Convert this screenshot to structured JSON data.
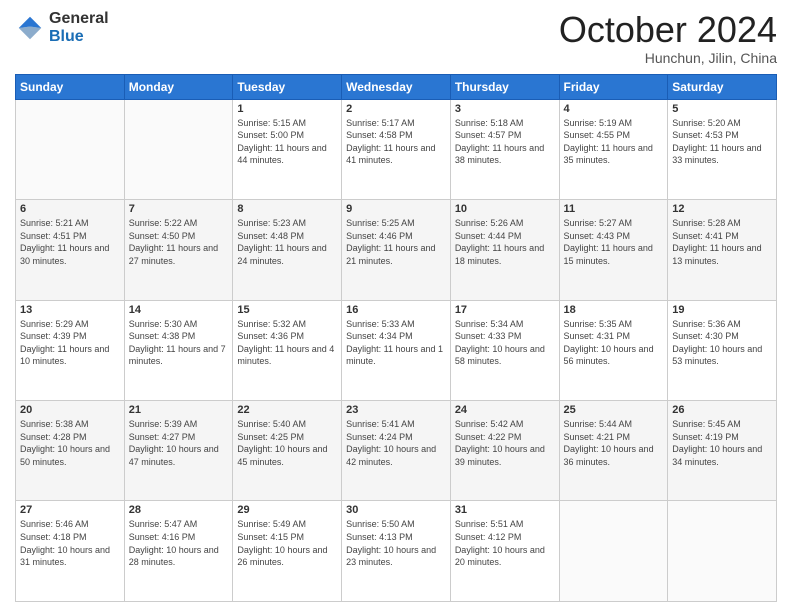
{
  "logo": {
    "general": "General",
    "blue": "Blue"
  },
  "header": {
    "month": "October 2024",
    "location": "Hunchun, Jilin, China"
  },
  "days_of_week": [
    "Sunday",
    "Monday",
    "Tuesday",
    "Wednesday",
    "Thursday",
    "Friday",
    "Saturday"
  ],
  "weeks": [
    [
      {
        "day": "",
        "sunrise": "",
        "sunset": "",
        "daylight": ""
      },
      {
        "day": "",
        "sunrise": "",
        "sunset": "",
        "daylight": ""
      },
      {
        "day": "1",
        "sunrise": "Sunrise: 5:15 AM",
        "sunset": "Sunset: 5:00 PM",
        "daylight": "Daylight: 11 hours and 44 minutes."
      },
      {
        "day": "2",
        "sunrise": "Sunrise: 5:17 AM",
        "sunset": "Sunset: 4:58 PM",
        "daylight": "Daylight: 11 hours and 41 minutes."
      },
      {
        "day": "3",
        "sunrise": "Sunrise: 5:18 AM",
        "sunset": "Sunset: 4:57 PM",
        "daylight": "Daylight: 11 hours and 38 minutes."
      },
      {
        "day": "4",
        "sunrise": "Sunrise: 5:19 AM",
        "sunset": "Sunset: 4:55 PM",
        "daylight": "Daylight: 11 hours and 35 minutes."
      },
      {
        "day": "5",
        "sunrise": "Sunrise: 5:20 AM",
        "sunset": "Sunset: 4:53 PM",
        "daylight": "Daylight: 11 hours and 33 minutes."
      }
    ],
    [
      {
        "day": "6",
        "sunrise": "Sunrise: 5:21 AM",
        "sunset": "Sunset: 4:51 PM",
        "daylight": "Daylight: 11 hours and 30 minutes."
      },
      {
        "day": "7",
        "sunrise": "Sunrise: 5:22 AM",
        "sunset": "Sunset: 4:50 PM",
        "daylight": "Daylight: 11 hours and 27 minutes."
      },
      {
        "day": "8",
        "sunrise": "Sunrise: 5:23 AM",
        "sunset": "Sunset: 4:48 PM",
        "daylight": "Daylight: 11 hours and 24 minutes."
      },
      {
        "day": "9",
        "sunrise": "Sunrise: 5:25 AM",
        "sunset": "Sunset: 4:46 PM",
        "daylight": "Daylight: 11 hours and 21 minutes."
      },
      {
        "day": "10",
        "sunrise": "Sunrise: 5:26 AM",
        "sunset": "Sunset: 4:44 PM",
        "daylight": "Daylight: 11 hours and 18 minutes."
      },
      {
        "day": "11",
        "sunrise": "Sunrise: 5:27 AM",
        "sunset": "Sunset: 4:43 PM",
        "daylight": "Daylight: 11 hours and 15 minutes."
      },
      {
        "day": "12",
        "sunrise": "Sunrise: 5:28 AM",
        "sunset": "Sunset: 4:41 PM",
        "daylight": "Daylight: 11 hours and 13 minutes."
      }
    ],
    [
      {
        "day": "13",
        "sunrise": "Sunrise: 5:29 AM",
        "sunset": "Sunset: 4:39 PM",
        "daylight": "Daylight: 11 hours and 10 minutes."
      },
      {
        "day": "14",
        "sunrise": "Sunrise: 5:30 AM",
        "sunset": "Sunset: 4:38 PM",
        "daylight": "Daylight: 11 hours and 7 minutes."
      },
      {
        "day": "15",
        "sunrise": "Sunrise: 5:32 AM",
        "sunset": "Sunset: 4:36 PM",
        "daylight": "Daylight: 11 hours and 4 minutes."
      },
      {
        "day": "16",
        "sunrise": "Sunrise: 5:33 AM",
        "sunset": "Sunset: 4:34 PM",
        "daylight": "Daylight: 11 hours and 1 minute."
      },
      {
        "day": "17",
        "sunrise": "Sunrise: 5:34 AM",
        "sunset": "Sunset: 4:33 PM",
        "daylight": "Daylight: 10 hours and 58 minutes."
      },
      {
        "day": "18",
        "sunrise": "Sunrise: 5:35 AM",
        "sunset": "Sunset: 4:31 PM",
        "daylight": "Daylight: 10 hours and 56 minutes."
      },
      {
        "day": "19",
        "sunrise": "Sunrise: 5:36 AM",
        "sunset": "Sunset: 4:30 PM",
        "daylight": "Daylight: 10 hours and 53 minutes."
      }
    ],
    [
      {
        "day": "20",
        "sunrise": "Sunrise: 5:38 AM",
        "sunset": "Sunset: 4:28 PM",
        "daylight": "Daylight: 10 hours and 50 minutes."
      },
      {
        "day": "21",
        "sunrise": "Sunrise: 5:39 AM",
        "sunset": "Sunset: 4:27 PM",
        "daylight": "Daylight: 10 hours and 47 minutes."
      },
      {
        "day": "22",
        "sunrise": "Sunrise: 5:40 AM",
        "sunset": "Sunset: 4:25 PM",
        "daylight": "Daylight: 10 hours and 45 minutes."
      },
      {
        "day": "23",
        "sunrise": "Sunrise: 5:41 AM",
        "sunset": "Sunset: 4:24 PM",
        "daylight": "Daylight: 10 hours and 42 minutes."
      },
      {
        "day": "24",
        "sunrise": "Sunrise: 5:42 AM",
        "sunset": "Sunset: 4:22 PM",
        "daylight": "Daylight: 10 hours and 39 minutes."
      },
      {
        "day": "25",
        "sunrise": "Sunrise: 5:44 AM",
        "sunset": "Sunset: 4:21 PM",
        "daylight": "Daylight: 10 hours and 36 minutes."
      },
      {
        "day": "26",
        "sunrise": "Sunrise: 5:45 AM",
        "sunset": "Sunset: 4:19 PM",
        "daylight": "Daylight: 10 hours and 34 minutes."
      }
    ],
    [
      {
        "day": "27",
        "sunrise": "Sunrise: 5:46 AM",
        "sunset": "Sunset: 4:18 PM",
        "daylight": "Daylight: 10 hours and 31 minutes."
      },
      {
        "day": "28",
        "sunrise": "Sunrise: 5:47 AM",
        "sunset": "Sunset: 4:16 PM",
        "daylight": "Daylight: 10 hours and 28 minutes."
      },
      {
        "day": "29",
        "sunrise": "Sunrise: 5:49 AM",
        "sunset": "Sunset: 4:15 PM",
        "daylight": "Daylight: 10 hours and 26 minutes."
      },
      {
        "day": "30",
        "sunrise": "Sunrise: 5:50 AM",
        "sunset": "Sunset: 4:13 PM",
        "daylight": "Daylight: 10 hours and 23 minutes."
      },
      {
        "day": "31",
        "sunrise": "Sunrise: 5:51 AM",
        "sunset": "Sunset: 4:12 PM",
        "daylight": "Daylight: 10 hours and 20 minutes."
      },
      {
        "day": "",
        "sunrise": "",
        "sunset": "",
        "daylight": ""
      },
      {
        "day": "",
        "sunrise": "",
        "sunset": "",
        "daylight": ""
      }
    ]
  ]
}
